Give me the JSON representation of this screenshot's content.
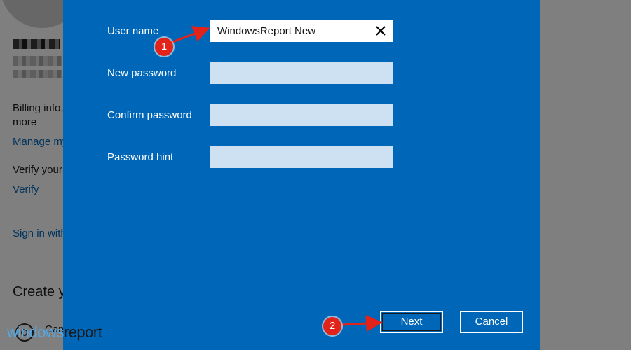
{
  "background": {
    "billing_text": "Billing info,",
    "more_text": "more",
    "manage_link": "Manage my",
    "verify_text": "Verify your",
    "verify_link": "Verify",
    "sign_in_link": "Sign in with",
    "create_heading": "Create y",
    "camera_text": "Cam"
  },
  "dialog": {
    "fields": [
      {
        "label": "User name",
        "value": "WindowsReport New"
      },
      {
        "label": "New password",
        "value": ""
      },
      {
        "label": "Confirm password",
        "value": ""
      },
      {
        "label": "Password hint",
        "value": ""
      }
    ],
    "next_label": "Next",
    "cancel_label": "Cancel"
  },
  "annotations": {
    "step1": "1",
    "step2": "2"
  },
  "watermark": {
    "part1": "windows",
    "part2": "report"
  },
  "colors": {
    "dialog_bg": "#0067b8",
    "input_idle": "#cde1f2",
    "annotation_red": "#e2231a",
    "link_blue": "#0067b8"
  }
}
